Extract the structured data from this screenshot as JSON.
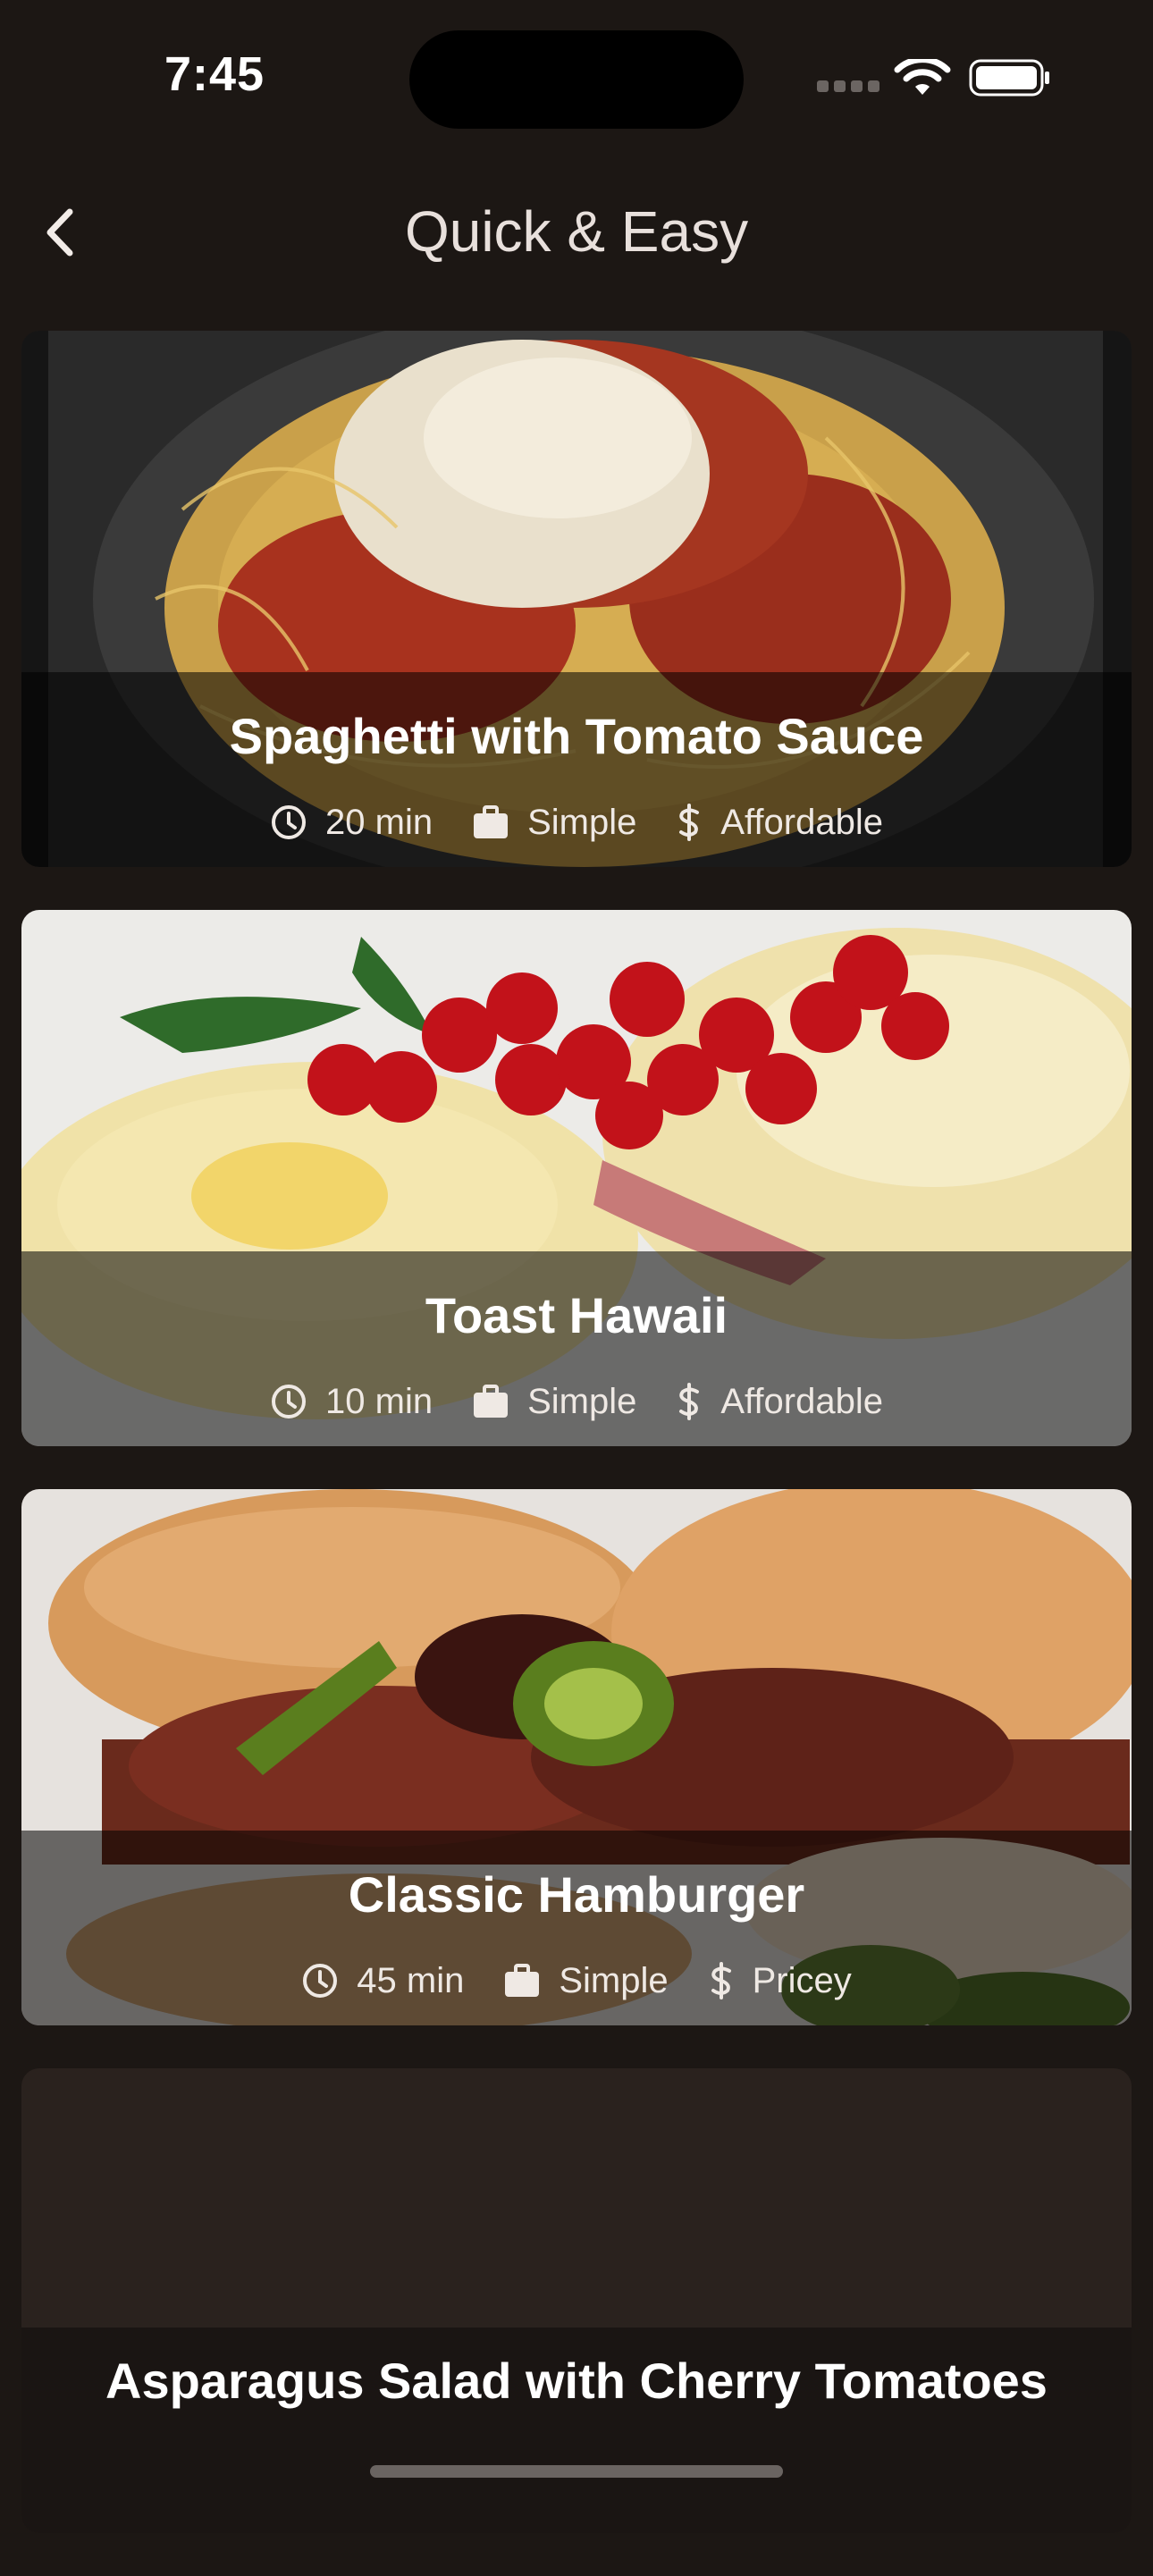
{
  "status_bar": {
    "time": "7:45"
  },
  "nav": {
    "title": "Quick & Easy",
    "back_icon": "chevron-left-icon"
  },
  "meals": [
    {
      "title": "Spaghetti with Tomato Sauce",
      "duration": "20 min",
      "complexity": "Simple",
      "affordability": "Affordable"
    },
    {
      "title": "Toast Hawaii",
      "duration": "10 min",
      "complexity": "Simple",
      "affordability": "Affordable"
    },
    {
      "title": "Classic Hamburger",
      "duration": "45 min",
      "complexity": "Simple",
      "affordability": "Pricey"
    },
    {
      "title": "Asparagus Salad with Cherry Tomatoes"
    }
  ],
  "icons": {
    "duration": "clock-icon",
    "complexity": "briefcase-icon",
    "affordability": "dollar-icon"
  },
  "colors": {
    "background": "#1c1714",
    "card_overlay": "rgba(0,0,0,0.55)",
    "text": "#ffffff"
  }
}
